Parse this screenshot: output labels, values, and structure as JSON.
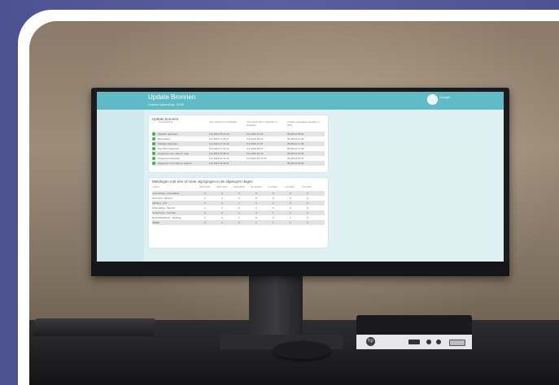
{
  "colors": {
    "backdrop": "#4d5293",
    "backdrop_stripe": "#5a5fa0",
    "frame": "#ffffff",
    "app_header": "#5fbcc6",
    "status_ok": "#3bb54a"
  },
  "screen": {
    "app_title": "Update Bronnen",
    "app_subtitle": "Laatste bijwerking: 15:00",
    "user_name": "Google",
    "user_role": "",
    "panel1_title": "Update bronnen",
    "panel1_headers": [
      "Omschrijving",
      "Voor gebeurd in Datalake",
      "Voor laatst door Upgrader in Datalake",
      "Laatste geslaagde Upgrade in Bron"
    ],
    "panel1_rows": [
      {
        "name": "Tabellen bijwerken",
        "c1": "6-9-2024 15:01:20",
        "c2": "6-9-2024 17:47",
        "c3": "05-08-24 09:02"
      },
      {
        "name": "Beoordelen",
        "c1": "6-9-2024 17:31:27",
        "c2": "6-9-2024 20:13",
        "c3": "05-08-24 17:34"
      },
      {
        "name": "Tabellen bijwerken",
        "c1": "6-9-2024 17:31:43",
        "c2": "6-9-2024 17:37",
        "c3": "05-08-24 17:08"
      },
      {
        "name": "Berichten bijwerken",
        "c1": "6-9-2024 17:31:44",
        "c2": "6-9-2024 16:17",
        "c3": "05-08-24 17:05"
      },
      {
        "name": "Gegevens voor data en rapp",
        "c1": "6-9-2024 15:58:11",
        "c2": "6-9-2024 16:42",
        "c3": "05-08-24 15:00"
      },
      {
        "name": "Gegevens bijwerken",
        "c1": "6-9-2024 16:47:21",
        "c2": "6-9-2024 16:47:20",
        "c3": "05-08-24 16:47"
      },
      {
        "name": "Gegevens voor data en rapport",
        "c1": "6-9-2024 15:30:31",
        "c2": "",
        "c3": "05-08-24 15:00"
      }
    ],
    "panel2_title": "Meldingen met één of meer wijzigingen in de afgelopen dagen",
    "panel2_label": "Labels",
    "panel2_dates": [
      "28-8-2024",
      "29-8-2024",
      "30-8-2024",
      "31-8-2024",
      "1-9-2024",
      "2-9-2024",
      "3-9-2024"
    ],
    "panel2_rows": [
      {
        "name": "Aanmelding - Intervalfout",
        "vals": [
          "0",
          "0",
          "0",
          "0",
          "0",
          "0",
          "0"
        ]
      },
      {
        "name": "Overzicht - Bericht",
        "vals": [
          "1",
          "1",
          "0",
          "0",
          "0",
          "0",
          "0"
        ]
      },
      {
        "name": "Melding - CM",
        "vals": [
          "0",
          "0",
          "1",
          "0",
          "0",
          "0",
          "0"
        ]
      },
      {
        "name": "Afhandeling - Bericht",
        "vals": [
          "1",
          "1",
          "0",
          "1",
          "0",
          "0",
          "0"
        ]
      },
      {
        "name": "Onderhoud - Controle",
        "vals": [
          "0",
          "0",
          "1",
          "0",
          "1",
          "0",
          "0"
        ]
      },
      {
        "name": "Beschikbaarheid - Melding",
        "vals": [
          "1",
          "0",
          "1",
          "0",
          "0",
          "1",
          "0"
        ]
      }
    ],
    "panel2_total_label": "Totaal",
    "panel2_totals": [
      "3",
      "2",
      "3",
      "1",
      "1",
      "1",
      "0"
    ]
  },
  "monitor": {
    "brand": "",
    "taskbar_tray": ""
  },
  "icons": {
    "user": "user-avatar-icon",
    "status": "status-ok-icon",
    "pc_logo": "hp-logo-icon"
  }
}
